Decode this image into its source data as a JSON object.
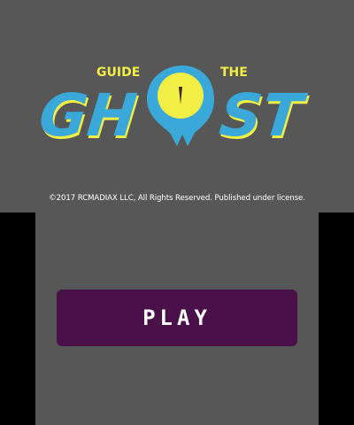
{
  "top_screen": {
    "logo": {
      "small_left": "GUIDE",
      "small_right": "THE",
      "main_left": "GH",
      "main_right": "ST",
      "color_fill": "#3aa8d8",
      "color_shadow": "#f1ee45",
      "ghost_icon": "ghost-eye-icon"
    },
    "copyright": "©2017 RCMADIAX LLC, All Rights Reserved. Published under license."
  },
  "bottom_screen": {
    "play_label": "PLAY",
    "play_color": "#4a1049"
  }
}
